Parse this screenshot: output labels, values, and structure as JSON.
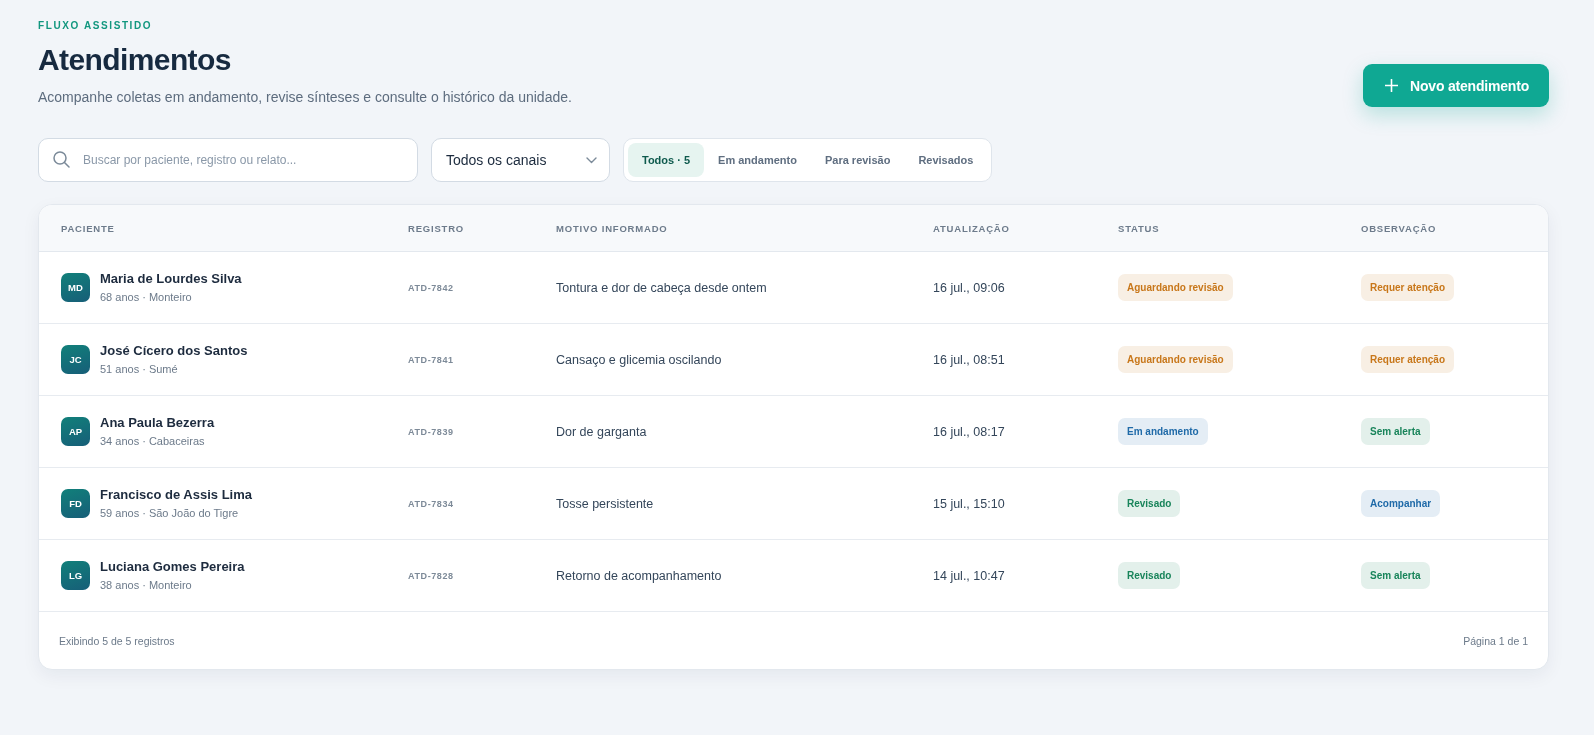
{
  "header": {
    "eyebrow": "FLUXO ASSISTIDO",
    "title": "Atendimentos",
    "subtitle": "Acompanhe coletas em andamento, revise sínteses e consulte o histórico da unidade."
  },
  "primary_button": {
    "label": "Novo atendimento"
  },
  "filters": {
    "search": {
      "placeholder": "Buscar por paciente, registro ou relato..."
    },
    "channel_select": {
      "value": "Todos os canais"
    },
    "tabs": [
      {
        "label": "Todos · 5",
        "selected": true
      },
      {
        "label": "Em andamento",
        "selected": false
      },
      {
        "label": "Para revisão",
        "selected": false
      },
      {
        "label": "Revisados",
        "selected": false
      }
    ]
  },
  "table": {
    "columns": [
      "PACIENTE",
      "REGISTRO",
      "MOTIVO INFORMADO",
      "ATUALIZAÇÃO",
      "STATUS",
      "OBSERVAÇÃO"
    ],
    "rows": [
      {
        "initials": "MD",
        "name": "Maria de Lourdes Silva",
        "details": "68 anos · Monteiro",
        "record": "ATD-7842",
        "reason": "Tontura e dor de cabeça desde ontem",
        "updated": "16 jul., 09:06",
        "status": {
          "label": "Aguardando revisão",
          "color": "#c8771a"
        },
        "note": {
          "label": "Requer atenção",
          "color": "#c8771a"
        }
      },
      {
        "initials": "JC",
        "name": "José Cícero dos Santos",
        "details": "51 anos · Sumé",
        "record": "ATD-7841",
        "reason": "Cansaço e glicemia oscilando",
        "updated": "16 jul., 08:51",
        "status": {
          "label": "Aguardando revisão",
          "color": "#c8771a"
        },
        "note": {
          "label": "Requer atenção",
          "color": "#c8771a"
        }
      },
      {
        "initials": "AP",
        "name": "Ana Paula Bezerra",
        "details": "34 anos · Cabaceiras",
        "record": "ATD-7839",
        "reason": "Dor de garganta",
        "updated": "16 jul., 08:17",
        "status": {
          "label": "Em andamento",
          "color": "#1f6aa8"
        },
        "note": {
          "label": "Sem alerta",
          "color": "#18845a"
        }
      },
      {
        "initials": "FD",
        "name": "Francisco de Assis Lima",
        "details": "59 anos · São João do Tigre",
        "record": "ATD-7834",
        "reason": "Tosse persistente",
        "updated": "15 jul., 15:10",
        "status": {
          "label": "Revisado",
          "color": "#18845a"
        },
        "note": {
          "label": "Acompanhar",
          "color": "#1f6aa8"
        }
      },
      {
        "initials": "LG",
        "name": "Luciana Gomes Pereira",
        "details": "38 anos · Monteiro",
        "record": "ATD-7828",
        "reason": "Retorno de acompanhamento",
        "updated": "14 jul., 10:47",
        "status": {
          "label": "Revisado",
          "color": "#18845a"
        },
        "note": {
          "label": "Sem alerta",
          "color": "#18845a"
        }
      }
    ]
  },
  "footer": {
    "summary": "Exibindo 5 de 5 registros",
    "pagination": "Página 1 de 1"
  }
}
